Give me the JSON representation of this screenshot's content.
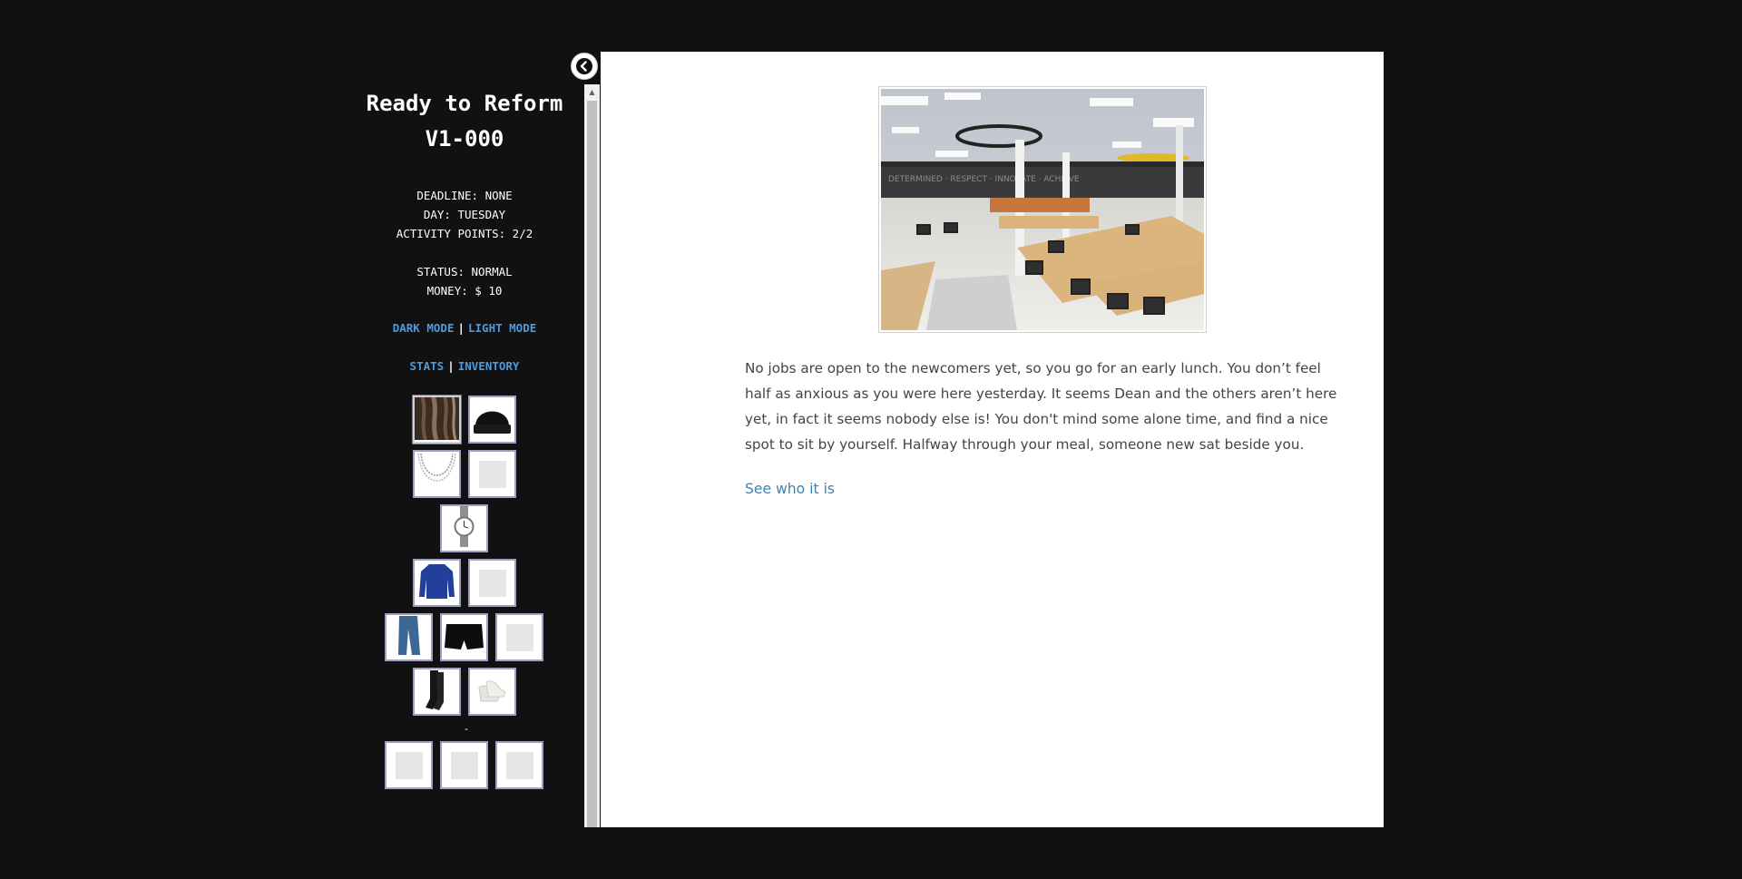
{
  "sidebar": {
    "title_line1": "Ready to Reform",
    "title_line2": "V1-000",
    "deadline": "DEADLINE: NONE",
    "day": "DAY: TUESDAY",
    "activity_points": "ACTIVITY POINTS: 2/2",
    "status": "STATUS: NORMAL",
    "money": "MONEY: $ 10",
    "dark_mode": "DARK MODE",
    "light_mode": "LIGHT MODE",
    "mode_separator": "|",
    "stats": "STATS",
    "inventory": "INVENTORY",
    "tab_separator": "|",
    "divider": "-",
    "outfit_slots": [
      {
        "item": "hair",
        "icon": "hair-icon"
      },
      {
        "item": "beanie",
        "icon": "beanie-icon"
      },
      {
        "item": "chain-necklace",
        "icon": "necklace-icon"
      },
      {
        "item": "empty",
        "icon": "empty-slot-icon"
      },
      {
        "item": "wristwatch",
        "icon": "watch-icon"
      },
      {
        "item": "blue-sweater",
        "icon": "sweater-icon"
      },
      {
        "item": "empty",
        "icon": "empty-slot-icon"
      },
      {
        "item": "jeans",
        "icon": "jeans-icon"
      },
      {
        "item": "black-shorts",
        "icon": "shorts-icon"
      },
      {
        "item": "empty",
        "icon": "empty-slot-icon"
      },
      {
        "item": "black-socks",
        "icon": "socks-icon"
      },
      {
        "item": "white-sneakers",
        "icon": "sneakers-icon"
      }
    ],
    "extra_slots": [
      "empty",
      "empty",
      "empty"
    ]
  },
  "passage": {
    "image": "cafeteria-photo",
    "text": "No jobs are open to the newcomers yet, so you go for an early lunch. You don’t feel half as anxious as you were here yesterday. It seems Dean and the others aren’t here yet, in fact it seems nobody else is! You don't mind some alone time, and find a nice spot to sit by yourself. Halfway through your meal, someone new sat beside you.",
    "choice": "See who it is"
  },
  "colors": {
    "background": "#111111",
    "link": "#4a9be0",
    "choice_link": "#3a84b5",
    "slot_border": "#a19ec3"
  }
}
